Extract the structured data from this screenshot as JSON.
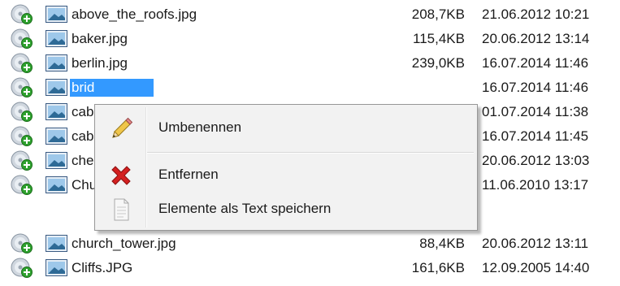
{
  "files": [
    {
      "name": "above_the_roofs.jpg",
      "size": "208,7KB",
      "date": "21.06.2012 10:21"
    },
    {
      "name": "baker.jpg",
      "size": "115,4KB",
      "date": "20.06.2012 13:14"
    },
    {
      "name": "berlin.jpg",
      "size": "239,0KB",
      "date": "16.07.2014 11:46"
    },
    {
      "name": "brid",
      "size": "",
      "date": "16.07.2014 11:46",
      "selected": true
    },
    {
      "name": "cab",
      "size": "",
      "date": "01.07.2014 11:38"
    },
    {
      "name": "cab",
      "size": "",
      "date": "16.07.2014 11:45"
    },
    {
      "name": "che",
      "size": "",
      "date": "20.06.2012 13:03"
    },
    {
      "name": "Chu",
      "size": "",
      "date": "11.06.2010 13:17"
    },
    {
      "name": "church_tower.jpg",
      "size": "88,4KB",
      "date": "20.06.2012 13:11"
    },
    {
      "name": "Cliffs.JPG",
      "size": "161,6KB",
      "date": "12.09.2005 14:40"
    }
  ],
  "row_icons": {
    "status": "cd-add-icon",
    "type": "image-file-icon"
  },
  "context_menu": {
    "items": [
      {
        "label": "Umbenennen",
        "icon": "pencil-icon"
      },
      {
        "label": "Entfernen",
        "icon": "red-x-icon"
      },
      {
        "label": "Elemente als Text speichern",
        "icon": "document-icon"
      }
    ]
  },
  "colors": {
    "selection": "#3399ff",
    "menu_bg": "#f2f2f2",
    "remove_icon": "#d42020"
  }
}
